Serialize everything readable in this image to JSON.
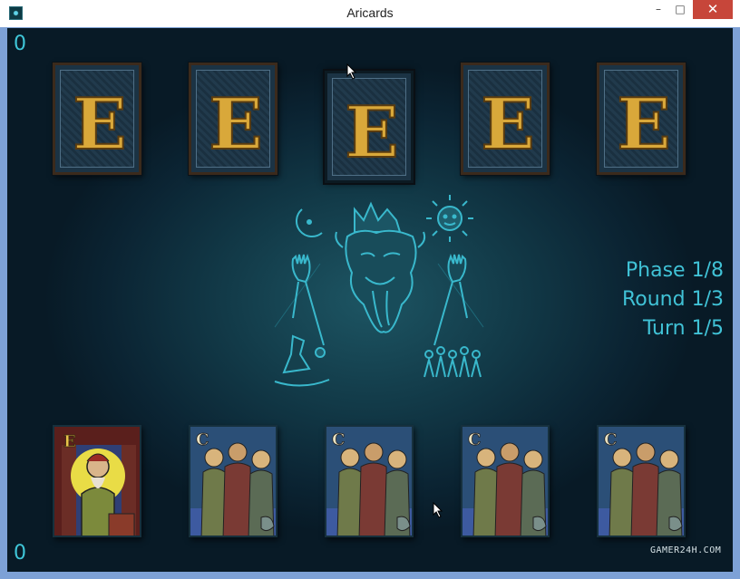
{
  "window": {
    "title": "Aricards",
    "min": "–",
    "max": "□",
    "close": "✕"
  },
  "scores": {
    "opponent": "0",
    "player": "0"
  },
  "status": {
    "phase": "Phase 1/8",
    "round": "Round 1/3",
    "turn": "Turn 1/5"
  },
  "opponent_hand": [
    {
      "face": "hidden",
      "letter": "E"
    },
    {
      "face": "hidden",
      "letter": "E"
    },
    {
      "face": "hidden",
      "letter": "E"
    },
    {
      "face": "hidden",
      "letter": "E"
    },
    {
      "face": "hidden",
      "letter": "E"
    }
  ],
  "player_hand": [
    {
      "letter": "E",
      "art": "king-card"
    },
    {
      "letter": "C",
      "art": "crowd-card"
    },
    {
      "letter": "C",
      "art": "crowd-card"
    },
    {
      "letter": "C",
      "art": "crowd-card"
    },
    {
      "letter": "C",
      "art": "crowd-card"
    }
  ],
  "center_icons": [
    "moon-icon",
    "king-icon",
    "sun-icon",
    "left-hand-icon",
    "right-hand-icon",
    "wizard-icon",
    "crowd-icon"
  ],
  "watermark": "GAMER24H.COM",
  "colors": {
    "accent": "#3fc6d8",
    "gold": "#d9a83a",
    "close": "#c7463a"
  }
}
